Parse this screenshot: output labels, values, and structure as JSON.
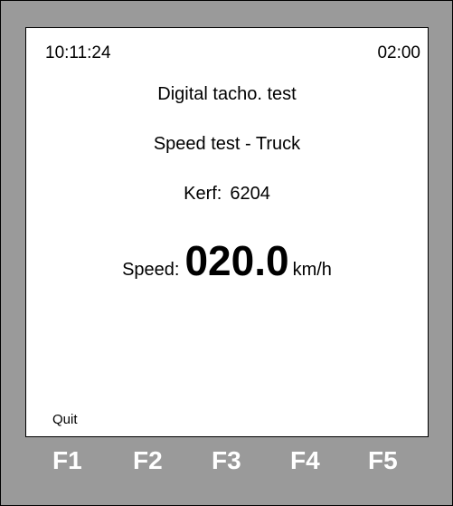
{
  "status_bar": {
    "clock": "10:11:24",
    "timer": "02:00"
  },
  "screen": {
    "title": "Digital tacho. test",
    "subtitle": "Speed test - Truck",
    "kerf_label": "Kerf:",
    "kerf_value": "6204",
    "speed_label": "Speed:",
    "speed_value": "020.0",
    "speed_unit": "km/h"
  },
  "softkeys": {
    "quit_label": "Quit"
  },
  "function_keys": [
    "F1",
    "F2",
    "F3",
    "F4",
    "F5"
  ],
  "colors": {
    "bezel": "#9a9a9a",
    "screen": "#ffffff",
    "text": "#000000",
    "function_key_text": "#ffffff"
  }
}
